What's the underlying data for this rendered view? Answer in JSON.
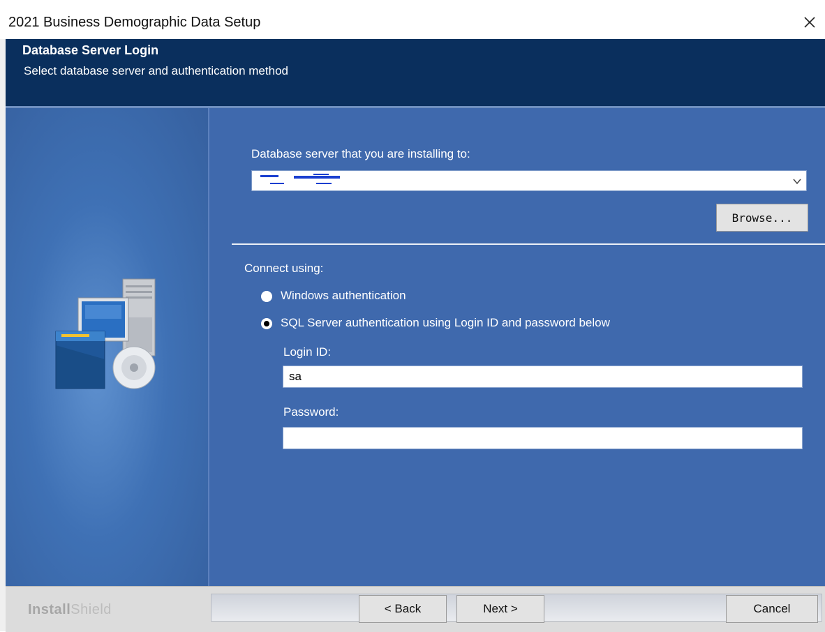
{
  "window": {
    "title": "2021 Business Demographic Data Setup"
  },
  "header": {
    "title": "Database Server Login",
    "subtitle": "Select database server and authentication method"
  },
  "server": {
    "label": "Database server that you are installing to:",
    "value": "",
    "browse_label": "Browse..."
  },
  "connect": {
    "label": "Connect using:",
    "options": [
      {
        "label": "Windows authentication",
        "selected": false
      },
      {
        "label": "SQL Server authentication using Login ID and password below",
        "selected": true
      }
    ]
  },
  "login": {
    "label": "Login ID:",
    "value": "sa"
  },
  "password": {
    "label": "Password:",
    "value": ""
  },
  "footer": {
    "brand_bold": "Install",
    "brand_light": "Shield",
    "back_label": "< Back",
    "next_label": "Next >",
    "cancel_label": "Cancel"
  },
  "colors": {
    "header_bg": "#0a2f5d",
    "content_bg": "#3f69ad",
    "text_on_blue": "#ffffff"
  }
}
